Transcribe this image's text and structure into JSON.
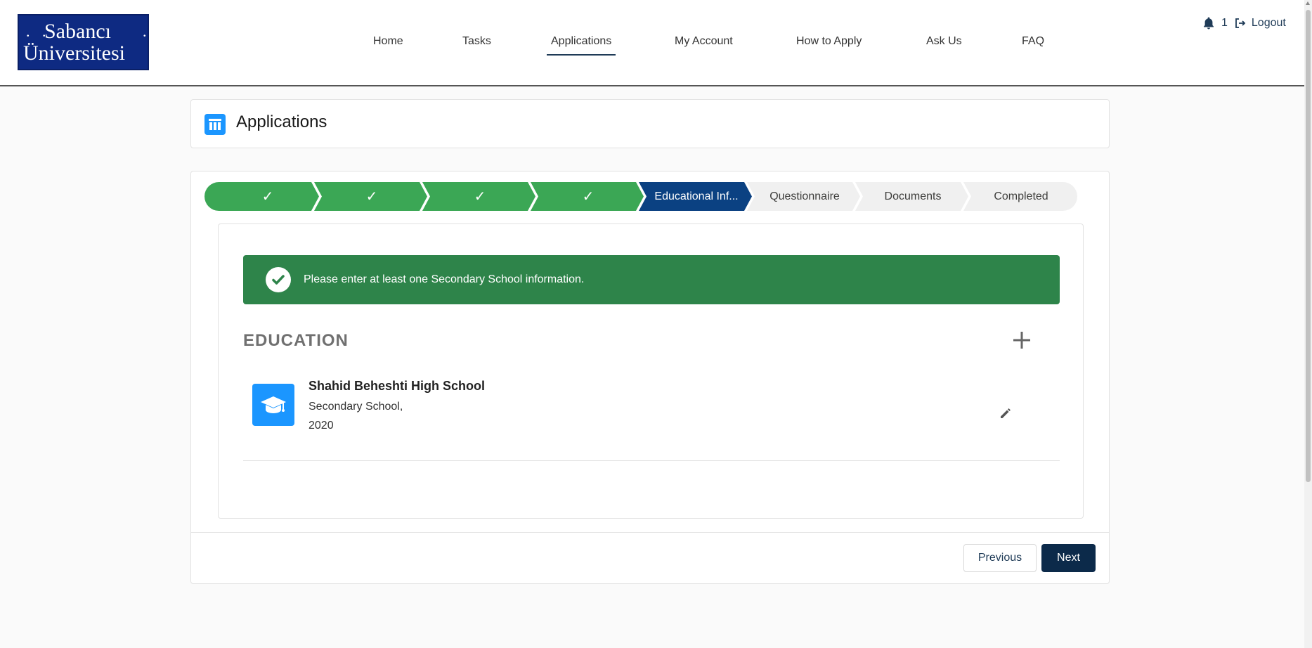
{
  "logo": {
    "line1": "Sabancı",
    "line2": "Üniversitesi"
  },
  "nav": {
    "items": [
      {
        "label": "Home"
      },
      {
        "label": "Tasks"
      },
      {
        "label": "Applications",
        "active": true
      },
      {
        "label": "My Account"
      },
      {
        "label": "How to Apply"
      },
      {
        "label": "Ask Us"
      },
      {
        "label": "FAQ"
      }
    ]
  },
  "topright": {
    "notification_count": "1",
    "logout_label": "Logout",
    "icons": [
      "bell-icon",
      "logout-icon"
    ]
  },
  "page": {
    "title": "Applications",
    "icon": "table-icon"
  },
  "path": {
    "steps": [
      {
        "label": "✓",
        "status": "complete"
      },
      {
        "label": "✓",
        "status": "complete"
      },
      {
        "label": "✓",
        "status": "complete"
      },
      {
        "label": "✓",
        "status": "complete"
      },
      {
        "label": "Educational Inf...",
        "status": "current"
      },
      {
        "label": "Questionnaire",
        "status": "incomplete"
      },
      {
        "label": "Documents",
        "status": "incomplete"
      },
      {
        "label": "Completed",
        "status": "incomplete"
      }
    ]
  },
  "alert": {
    "message": "Please enter at least one Secondary School information.",
    "icon": "check-circle-icon"
  },
  "education": {
    "title": "EDUCATION",
    "add_icon": "plus-icon",
    "entries": [
      {
        "school": "Shahid Beheshti High School",
        "type": "Secondary School,",
        "year": "2020",
        "icon": "graduation-cap-icon",
        "edit_icon": "pencil-icon"
      }
    ]
  },
  "buttons": {
    "previous": "Previous",
    "next": "Next"
  },
  "colors": {
    "complete": "#3ba755",
    "current": "#0b4182",
    "incomplete": "#f0f0f0",
    "alert": "#2e844a",
    "accent": "#1b96ff",
    "next_button": "#0c2a4a"
  }
}
